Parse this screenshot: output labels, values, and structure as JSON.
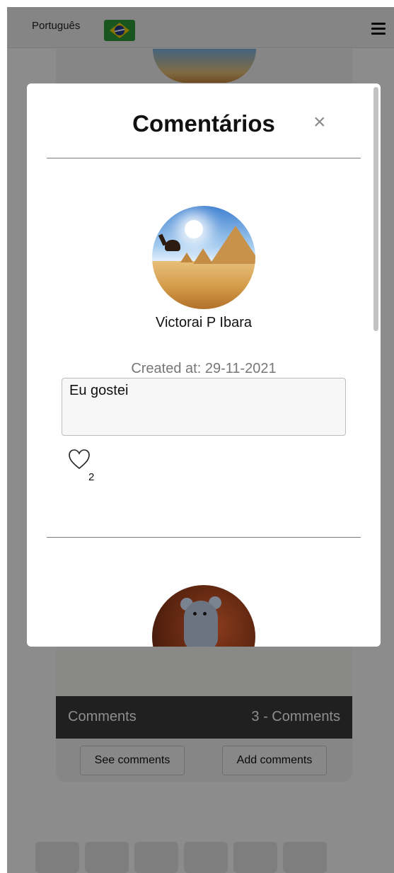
{
  "header": {
    "language_label": "Português",
    "flag_icon": "brazil-flag-icon",
    "menu_icon": "hamburger-menu-icon"
  },
  "background_card": {
    "footer_left": "Comments",
    "footer_right": "3 - Comments",
    "see_comments_label": "See comments",
    "add_comments_label": "Add comments"
  },
  "modal": {
    "title": "Comentários",
    "close_symbol": "×",
    "comments": [
      {
        "author": "Victorai P Ibara",
        "created_at": "Created at: 29-11-2021",
        "text": "Eu gostei",
        "likes": "2",
        "like_icon": "heart-outline-icon"
      }
    ]
  },
  "colors": {
    "overlay": "#000000",
    "footer_bg": "#3b3b3b",
    "close_icon": "#8a8a8a",
    "created_text": "#777777"
  }
}
